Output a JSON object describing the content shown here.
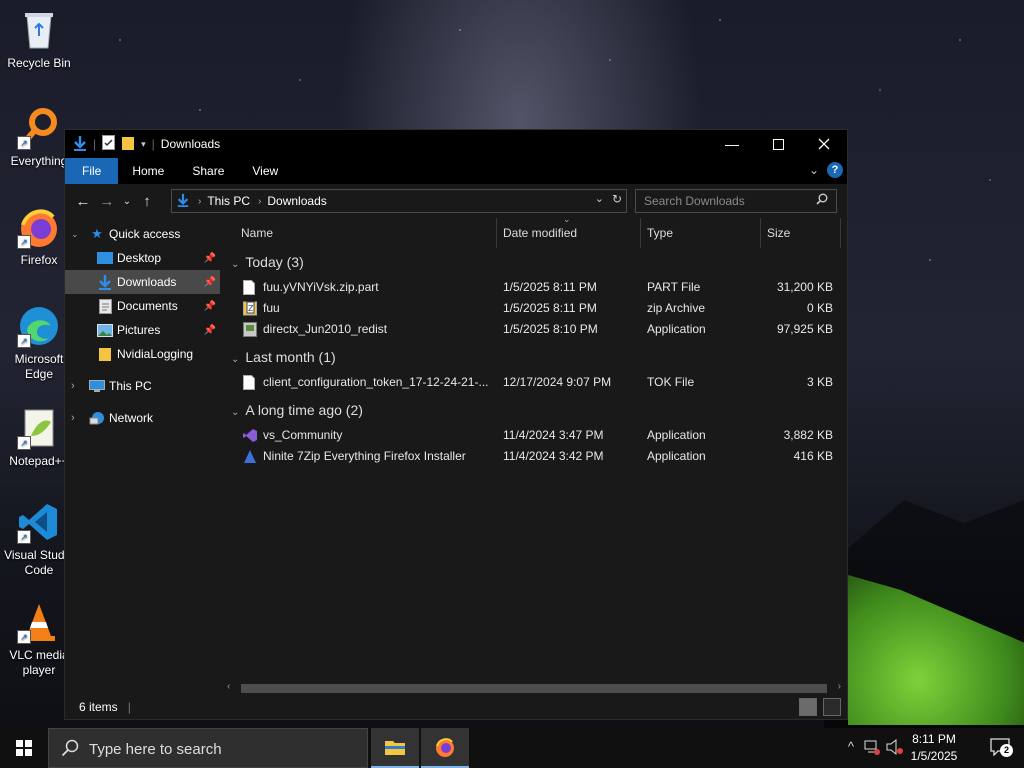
{
  "desktop": {
    "icons": [
      {
        "label": "Recycle Bin"
      },
      {
        "label": "Everything"
      },
      {
        "label": "Firefox"
      },
      {
        "label": "Microsoft Edge"
      },
      {
        "label": "Notepad++"
      },
      {
        "label": "Visual Studio Code"
      },
      {
        "label": "VLC media player"
      }
    ]
  },
  "window": {
    "title": "Downloads",
    "ribbon_tabs": [
      "File",
      "Home",
      "Share",
      "View"
    ],
    "help": "?",
    "address": {
      "crumbs": [
        "This PC",
        "Downloads"
      ]
    },
    "search_placeholder": "Search Downloads",
    "nav": [
      {
        "label": "Quick access",
        "icon": "star-icon",
        "level": 0,
        "expandable": true
      },
      {
        "label": "Desktop",
        "icon": "desktop-icon",
        "level": 1,
        "pinned": true
      },
      {
        "label": "Downloads",
        "icon": "download-icon",
        "level": 1,
        "pinned": true,
        "selected": true
      },
      {
        "label": "Documents",
        "icon": "documents-icon",
        "level": 1,
        "pinned": true
      },
      {
        "label": "Pictures",
        "icon": "pictures-icon",
        "level": 1,
        "pinned": true
      },
      {
        "label": "NvidiaLogging",
        "icon": "folder-icon",
        "level": 1
      },
      {
        "label": "This PC",
        "icon": "pc-icon",
        "level": 0,
        "expandable": true
      },
      {
        "label": "Network",
        "icon": "network-icon",
        "level": 0,
        "expandable": true
      }
    ],
    "columns": {
      "name": "Name",
      "date": "Date modified",
      "type": "Type",
      "size": "Size"
    },
    "groups": [
      {
        "label": "Today (3)",
        "files": [
          {
            "name": "fuu.yVNYiVsk.zip.part",
            "date": "1/5/2025 8:11 PM",
            "type": "PART File",
            "size": "31,200 KB",
            "icon": "blank-file-icon"
          },
          {
            "name": "fuu",
            "date": "1/5/2025 8:11 PM",
            "type": "zip Archive",
            "size": "0 KB",
            "icon": "zip-icon"
          },
          {
            "name": "directx_Jun2010_redist",
            "date": "1/5/2025 8:10 PM",
            "type": "Application",
            "size": "97,925 KB",
            "icon": "installer-icon"
          }
        ]
      },
      {
        "label": "Last month (1)",
        "files": [
          {
            "name": "client_configuration_token_17-12-24-21-...",
            "date": "12/17/2024 9:07 PM",
            "type": "TOK File",
            "size": "3 KB",
            "icon": "blank-file-icon"
          }
        ]
      },
      {
        "label": "A long time ago (2)",
        "files": [
          {
            "name": "vs_Community",
            "date": "11/4/2024 3:47 PM",
            "type": "Application",
            "size": "3,882 KB",
            "icon": "visual-studio-icon"
          },
          {
            "name": "Ninite 7Zip Everything Firefox Installer",
            "date": "11/4/2024 3:42 PM",
            "type": "Application",
            "size": "416 KB",
            "icon": "ninite-icon"
          }
        ]
      }
    ],
    "status": "6 items"
  },
  "taskbar": {
    "search_placeholder": "Type here to search",
    "time": "8:11 PM",
    "date": "1/5/2025",
    "notification_count": "2"
  },
  "colors": {
    "accent": "#1a67b6",
    "window_bg": "#191919",
    "selected_nav": "#494949"
  }
}
